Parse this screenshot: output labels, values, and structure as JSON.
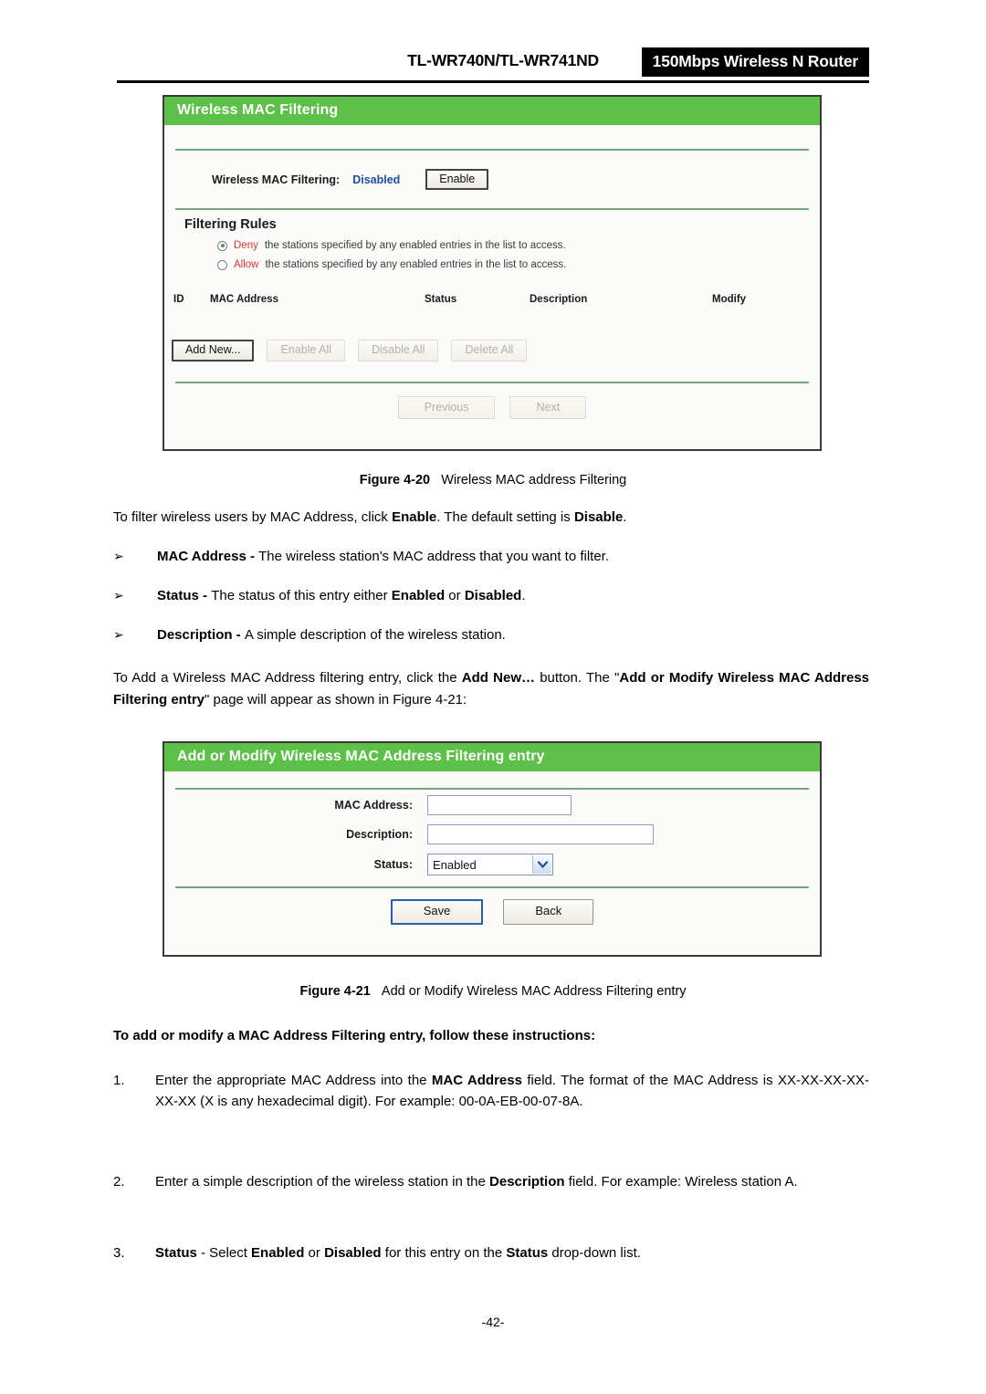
{
  "header": {
    "model": "TL-WR740N/TL-WR741ND",
    "badge": "150Mbps Wireless N Router"
  },
  "panel1": {
    "title": "Wireless MAC Filtering",
    "state_label": "Wireless MAC Filtering:",
    "state_value": "Disabled",
    "enable_button": "Enable",
    "rules_title": "Filtering Rules",
    "rules": [
      {
        "keyword": "Deny",
        "text": "the stations specified by any enabled entries in the list to access.",
        "checked": true
      },
      {
        "keyword": "Allow",
        "text": "the stations specified by any enabled entries in the list to access.",
        "checked": false
      }
    ],
    "table_headers": {
      "id": "ID",
      "mac": "MAC Address",
      "status": "Status",
      "description": "Description",
      "modify": "Modify"
    },
    "action_buttons": {
      "add_new": "Add New...",
      "enable_all": "Enable All",
      "disable_all": "Disable All",
      "delete_all": "Delete All"
    },
    "pager": {
      "previous": "Previous",
      "next": "Next"
    }
  },
  "panel2": {
    "title": "Add or Modify Wireless MAC Address Filtering entry",
    "fields": {
      "mac_label": "MAC Address:",
      "mac_value": "",
      "desc_label": "Description:",
      "desc_value": "",
      "status_label": "Status:",
      "status_value": "Enabled"
    },
    "buttons": {
      "save": "Save",
      "back": "Back"
    }
  },
  "captions": {
    "fig1_num": "Figure 4-20",
    "fig1_text": "Wireless MAC address Filtering",
    "fig2_num": "Figure 4-21",
    "fig2_text": "Add or Modify Wireless MAC Address Filtering entry"
  },
  "body": {
    "intro_1": "To filter wireless users by MAC Address, click ",
    "intro_1_b1": "Enable",
    "intro_2": ". The default setting is ",
    "intro_1_b2": "Disable",
    "intro_3": ".",
    "bullet_marker": "➢",
    "bullets": [
      {
        "term": "MAC Address",
        "sep": " - ",
        "desc": "The wireless station's MAC address that you want to filter."
      },
      {
        "term": "Status",
        "sep": " - ",
        "desc_pre": "The status of this entry either ",
        "desc_b1": "Enabled",
        "desc_mid": " or ",
        "desc_b2": "Disabled",
        "desc_post": "."
      },
      {
        "term": "Description",
        "sep": " - ",
        "desc": "A simple description of the wireless station."
      }
    ],
    "addnew_pre": "To Add a Wireless MAC Address filtering entry, click the ",
    "addnew_b1": "Add New…",
    "addnew_mid": " button. The \"",
    "addnew_b2": "Add or Modify Wireless MAC Address Filtering entry",
    "addnew_post": "\" page will appear as shown in Figure 4-21:",
    "instructions_heading": "To add or modify a MAC Address Filtering entry, follow these instructions:",
    "steps": [
      {
        "num": "1.",
        "pre": "Enter the appropriate MAC Address into the ",
        "b1": "MAC Address",
        "post": " field. The format of the MAC Address is XX-XX-XX-XX-XX-XX (X is any hexadecimal digit). For example: 00-0A-EB-00-07-8A."
      },
      {
        "num": "2.",
        "pre": "Enter a simple description of the wireless station in the ",
        "b1": "Description",
        "post": " field. For example: Wireless station A."
      },
      {
        "num": "3.",
        "b_lead": "Status",
        "pre": " - Select ",
        "b1": "Enabled",
        "mid": " or ",
        "b2": "Disabled",
        "mid2": " for this entry on the ",
        "b3": "Status",
        "post": " drop-down list."
      }
    ],
    "page_number": "-42-"
  },
  "colors": {
    "panel_header_green": "#5dc049",
    "divider_green": "#74a47e",
    "status_blue": "#1f4e9c",
    "keyword_red": "#e03636"
  }
}
